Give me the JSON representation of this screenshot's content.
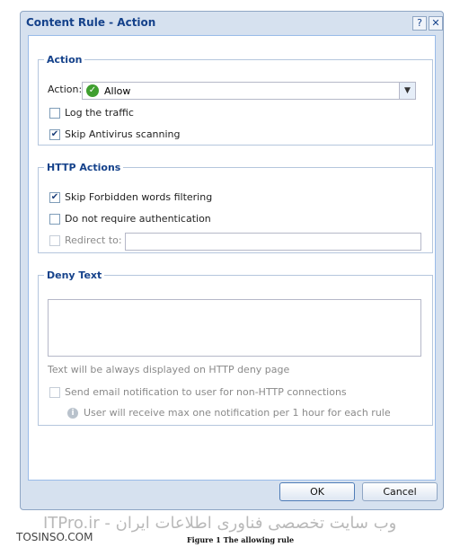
{
  "dialog": {
    "title": "Content Rule - Action",
    "help_button": "?",
    "close_button": "✕"
  },
  "action_section": {
    "legend": "Action",
    "action_label": "Action:",
    "action_value": "Allow",
    "action_icon": "check-circle-icon",
    "log_traffic": {
      "label": "Log the traffic",
      "checked": false
    },
    "skip_antivirus": {
      "label": "Skip Antivirus scanning",
      "checked": true
    }
  },
  "http_section": {
    "legend": "HTTP Actions",
    "skip_forbidden": {
      "label": "Skip Forbidden words filtering",
      "checked": true
    },
    "no_auth": {
      "label": "Do not require authentication",
      "checked": false
    },
    "redirect": {
      "label": "Redirect to:",
      "checked": false,
      "value": ""
    }
  },
  "deny_section": {
    "legend": "Deny Text",
    "deny_text": "",
    "hint": "Text will be always displayed on HTTP deny page",
    "send_email": {
      "label": "Send email notification to user for non-HTTP connections",
      "checked": false
    },
    "info": "User will receive max one notification per 1 hour for each rule"
  },
  "buttons": {
    "ok": "OK",
    "cancel": "Cancel"
  },
  "watermark": {
    "text": "ITPro.ir - وب سایت تخصصی فناوری اطلاعات ایران",
    "tosinso": "TOSINSO.COM"
  },
  "caption": "Figure 1    The allowing rule",
  "colors": {
    "title": "#15428b",
    "frame": "#d6e1ef",
    "allow_icon": "#3f9f2f"
  }
}
